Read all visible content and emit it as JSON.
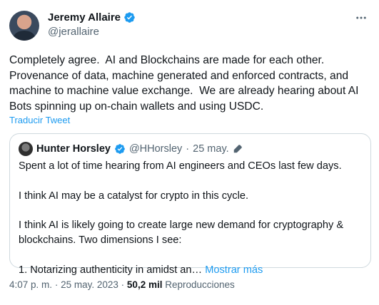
{
  "author": {
    "name": "Jeremy Allaire",
    "handle": "@jerallaire"
  },
  "tweet": {
    "text": "Completely agree.  AI and Blockchains are made for each other.\nProvenance of data, machine generated and enforced contracts, and\nmachine to machine value exchange.  We are already hearing about AI\nBots spinning up on-chain wallets and using USDC.",
    "translate_label": "Traducir Tweet"
  },
  "quote": {
    "name": "Hunter Horsley",
    "handle": "@HHorsley",
    "separator": "·",
    "date": "25 may.",
    "text": "Spent a lot of time hearing from AI engineers and CEOs last few days.\n\nI think AI may be a catalyst for crypto in this cycle.\n\nI think AI is likely going to create large new demand for cryptography &\nblockchains. Two dimensions I see:\n\n1. Notarizing authenticity in amidst an… ",
    "show_more": "Mostrar más"
  },
  "meta": {
    "time": "4:07 p. m.",
    "sep1": "·",
    "date": "25 may. 2023",
    "sep2": "·",
    "views": "50,2 mil",
    "views_label": "Reproducciones"
  },
  "colors": {
    "accent": "#1d9bf0",
    "text": "#0f1419",
    "secondary": "#536471",
    "border": "#cfd9de"
  },
  "icons": {
    "verified": "verified-badge-icon",
    "more": "more-dots-icon",
    "edit": "pencil-edit-icon"
  }
}
